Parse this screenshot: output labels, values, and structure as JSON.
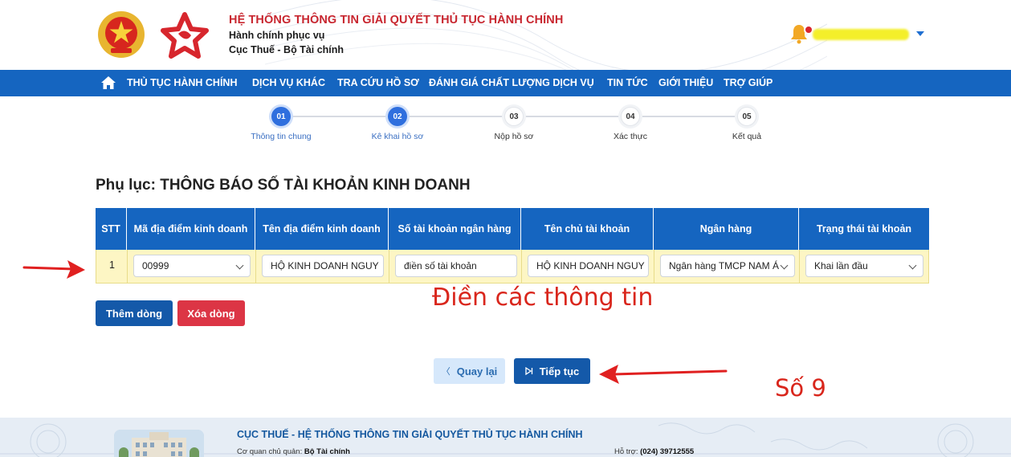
{
  "header": {
    "brand_title": "HỆ THỐNG THÔNG TIN GIẢI QUYẾT THỦ TỤC HÀNH CHÍNH",
    "brand_sub1": "Hành chính phục vụ",
    "brand_sub2": "Cục Thuế - Bộ Tài chính"
  },
  "nav": {
    "items": [
      "THỦ TỤC HÀNH CHÍNH",
      "DỊCH VỤ KHÁC",
      "TRA CỨU HỒ SƠ",
      "ĐÁNH GIÁ CHẤT LƯỢNG DỊCH VỤ",
      "TIN TỨC",
      "GIỚI THIỆU",
      "TRỢ GIÚP"
    ]
  },
  "stepper": {
    "steps": [
      {
        "num": "01",
        "label": "Thông tin chung",
        "state": "active"
      },
      {
        "num": "02",
        "label": "Kê khai hồ sơ",
        "state": "active"
      },
      {
        "num": "03",
        "label": "Nộp hồ sơ",
        "state": "inactive"
      },
      {
        "num": "04",
        "label": "Xác thực",
        "state": "inactive"
      },
      {
        "num": "05",
        "label": "Kết quả",
        "state": "inactive"
      }
    ]
  },
  "section_title": "Phụ lục: THÔNG BÁO SỐ TÀI KHOẢN KINH DOANH",
  "table": {
    "headers": [
      "STT",
      "Mã địa điểm kinh doanh",
      "Tên địa điểm kinh doanh",
      "Số tài khoản ngân hàng",
      "Tên chủ tài khoản",
      "Ngân hàng",
      "Trạng thái tài khoản"
    ],
    "row": {
      "stt": "1",
      "ma_dia_diem": "00999",
      "ten_dia_diem": "HỘ KINH DOANH NGUY",
      "so_tai_khoan": "điền số tài khoản",
      "ten_chu_tk": "HỘ KINH DOANH NGUY",
      "ngan_hang": "Ngân hàng TMCP NAM Á",
      "trang_thai": "Khai lần đầu"
    }
  },
  "buttons": {
    "add_row": "Thêm dòng",
    "delete_row": "Xóa dòng",
    "back": "Quay lại",
    "next": "Tiếp tục"
  },
  "annotations": {
    "fill_info": "Điền các thông tin",
    "step_number": "Số 9"
  },
  "footer": {
    "title": "CỤC THUẾ - HỆ THỐNG THÔNG TIN GIẢI QUYẾT THỦ TỤC HÀNH CHÍNH",
    "owner_label": "Cơ quan chủ quản:",
    "owner_value": "Bộ Tài chính",
    "support_label": "Hỗ trợ:",
    "support_value": "(024) 39712555"
  },
  "colors": {
    "nav_blue": "#1565c0",
    "brand_red": "#c8262f",
    "annotation_red": "#d9261c",
    "row_highlight": "#fdf6c4"
  }
}
